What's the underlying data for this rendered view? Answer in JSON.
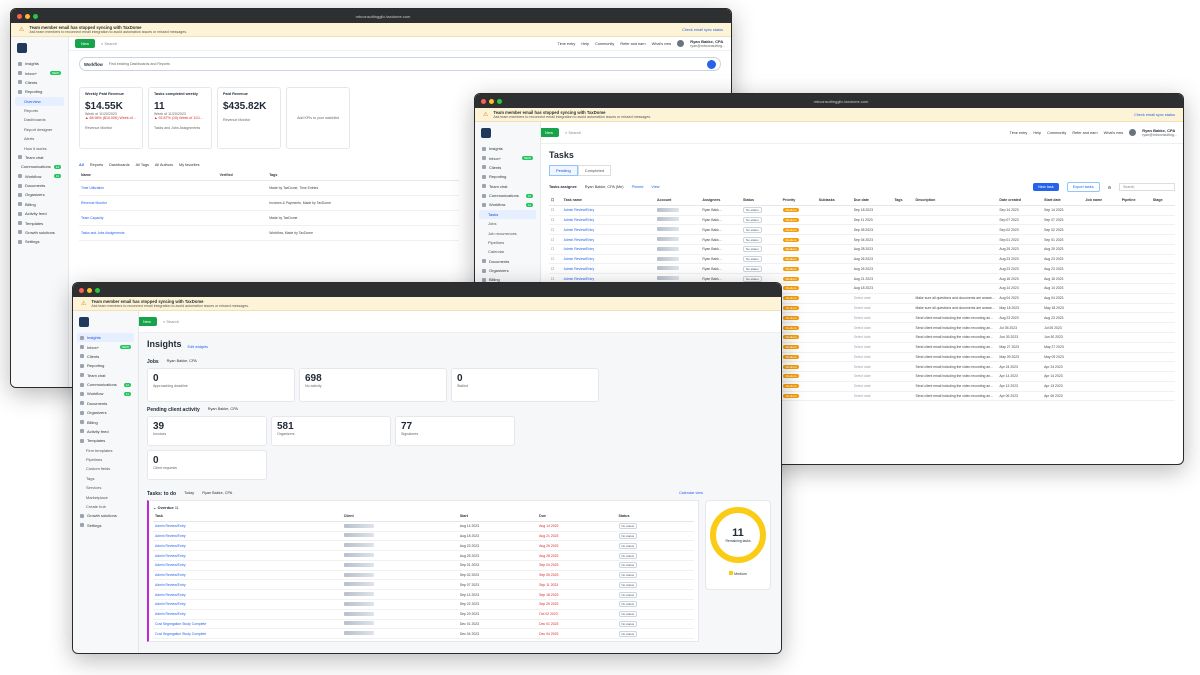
{
  "banner": {
    "title": "Team member email has stopped syncing with TaxDome",
    "desc": "Ask team members to reconnect email integration to avoid automation issues or missed messages.",
    "link": "Check email sync status"
  },
  "urls": {
    "back": "mbconsultinggllc.taxdome.com",
    "mid": "mbconsultinggllc.taxdome.com"
  },
  "topbar": {
    "new": "New",
    "search": "Search",
    "time_entry": "Time entry",
    "help": "Help",
    "community": "Community",
    "refer": "Refer and earn",
    "whats_new": "What's new",
    "user_name": "Ryan Bakke, CPA",
    "user_email": "ryan@mbconsulting..."
  },
  "sidebar_back": [
    "Insights",
    "Inbox+",
    "Clients",
    "Reporting",
    "Overview",
    "Reports",
    "Dashboards",
    "Report designer",
    "Alerts",
    "How it works",
    "Team chat",
    "Communications",
    "Workflow",
    "Documents",
    "Organizers",
    "Billing",
    "Activity feed",
    "Templates",
    "Growth solutions",
    "Settings"
  ],
  "sidebar_right": [
    "Insights",
    "Inbox+",
    "Clients",
    "Reporting",
    "Team chat",
    "Communications",
    "Workflow",
    "Tasks",
    "Jobs",
    "Job recurrences",
    "Pipelines",
    "Calendar",
    "Documents",
    "Organizers",
    "Billing",
    "Activity feed",
    "Templates",
    "Growth solutions",
    "Settings"
  ],
  "sidebar_front": [
    "Insights",
    "Inbox+",
    "Clients",
    "Reporting",
    "Team chat",
    "Communications",
    "Workflow",
    "Documents",
    "Organizers",
    "Billing",
    "Activity feed",
    "Templates",
    "Firm templates",
    "Pipelines",
    "Custom fields",
    "Tags",
    "Services",
    "Marketplace",
    "Create hub",
    "Growth solutions",
    "Settings"
  ],
  "badges": {
    "inbox": "NEW",
    "comm": "12",
    "workflow": "11"
  },
  "back": {
    "workflow_label": "Workflow",
    "ask": "Find existing Dashboards and Reports",
    "cards": [
      {
        "title": "Weekly Paid Revenue",
        "value": "$14.55K",
        "sub": "Week of 11/20/2023",
        "delta": "▲ 68.98% ($10.00K) Week of...",
        "foot": "Revenue Monitor"
      },
      {
        "title": "Tasks completed weekly",
        "value": "11",
        "sub": "Week of 11/20/2023",
        "delta": "▲ 92.87% (10) Week of 11/1...",
        "foot": "Tasks and Jobs Assignments"
      },
      {
        "title": "Paid Revenue",
        "value": "$435.82K",
        "sub": "",
        "delta": "",
        "foot": "Revenue Monitor"
      }
    ],
    "add_kpi": "Add KPIs to your watchlist",
    "filters": [
      "All",
      "Reports",
      "Dashboards",
      "All Tags",
      "All Authors",
      "My favorites"
    ],
    "cols": [
      "Name",
      "Verified",
      "Tags"
    ],
    "rows": [
      {
        "name": "Time Utilization",
        "tags": "Made by TaxDome, Time Entries"
      },
      {
        "name": "Revenue Monitor",
        "tags": "Invoices & Payments, Made by TaxDome"
      },
      {
        "name": "Team Capacity",
        "tags": "Made by TaxDome"
      },
      {
        "name": "Tasks and Jobs Assignments",
        "tags": "Workflow, Made by TaxDome"
      }
    ]
  },
  "right": {
    "title": "Tasks",
    "tabs": [
      "Pending",
      "Completed"
    ],
    "filter1": "Tasks assignee",
    "filter2": "Ryan Bakke, CPA (Me)",
    "filter3": "Pinned",
    "filter4": "View",
    "new_task": "New task",
    "export": "Export tasks",
    "search": "Search",
    "cols": [
      "Task name",
      "Account",
      "Assignees",
      "Status",
      "Priority",
      "Subtasks",
      "Due date",
      "Tags",
      "Description",
      "Date created",
      "Start date",
      "Job name",
      "Pipeline",
      "Stage"
    ],
    "rows": [
      {
        "n": "Admin Review/Entry",
        "d": "Sep 18 2023",
        "c": "Sep 14 2023",
        "s": "Sep 14 2023",
        "desc": ""
      },
      {
        "n": "Admin Review/Entry",
        "d": "Sep 11 2023",
        "c": "Sep 07 2023",
        "s": "Sep 07 2023",
        "desc": ""
      },
      {
        "n": "Admin Review/Entry",
        "d": "Sep 05 2023",
        "c": "Sep 02 2023",
        "s": "Sep 02 2023",
        "desc": ""
      },
      {
        "n": "Admin Review/Entry",
        "d": "Sep 04 2023",
        "c": "Sep 01 2023",
        "s": "Sep 01 2023",
        "desc": ""
      },
      {
        "n": "Admin Review/Entry",
        "d": "Aug 28 2023",
        "c": "Aug 25 2023",
        "s": "Aug 25 2023",
        "desc": ""
      },
      {
        "n": "Admin Review/Entry",
        "d": "Aug 26 2023",
        "c": "Aug 23 2023",
        "s": "Aug 23 2023",
        "desc": ""
      },
      {
        "n": "Admin Review/Entry",
        "d": "Aug 26 2023",
        "c": "Aug 23 2023",
        "s": "Aug 23 2023",
        "desc": ""
      },
      {
        "n": "Admin Review/Entry",
        "d": "Aug 21 2023",
        "c": "Aug 18 2023",
        "s": "Aug 18 2023",
        "desc": ""
      },
      {
        "n": "Admin Review/Entry",
        "d": "Aug 18 2023",
        "c": "Aug 14 2023",
        "s": "Aug 14 2023",
        "desc": ""
      },
      {
        "n": "Advisory: Confirm Onboarding...",
        "d": "Select date",
        "c": "Aug 04 2023",
        "s": "Aug 04 2023",
        "desc": "Make sure all questions and documents are answered an..."
      },
      {
        "n": "Advisory: Confirm Onboarding...",
        "d": "Select date",
        "c": "May 18 2023",
        "s": "May 18 2023",
        "desc": "Make sure all questions and documents are answered an..."
      },
      {
        "n": "Advisory: Send Consulting Call...",
        "d": "Select date",
        "c": "Aug 23 2023",
        "s": "Aug 23 2023",
        "desc": "Send client email including the video recording and any..."
      },
      {
        "n": "Advisory: Send Consulting Call...",
        "d": "Select date",
        "c": "Jul 05 2023",
        "s": "Jul 05 2023",
        "desc": "Send client email including the video recording and any..."
      },
      {
        "n": "Advisory: Send Consulting Call...",
        "d": "Select date",
        "c": "Jun 30 2023",
        "s": "Jun 30 2023",
        "desc": "Send client email including the video recording and any..."
      },
      {
        "n": "Advisory: Send Consulting Call...",
        "d": "Select date",
        "c": "May 27 2023",
        "s": "May 27 2023",
        "desc": "Send client email including the video recording and any..."
      },
      {
        "n": "Advisory: Send Consulting Call...",
        "d": "Select date",
        "c": "May 09 2023",
        "s": "May 09 2023",
        "desc": "Send client email including the video recording and any..."
      },
      {
        "n": "Advisory: Send Consulting Call...",
        "d": "Select date",
        "c": "Apr 24 2023",
        "s": "Apr 24 2023",
        "desc": "Send client email including the video recording and any..."
      },
      {
        "n": "Advisory: Send Consulting Call...",
        "d": "Select date",
        "c": "Apr 14 2023",
        "s": "Apr 14 2023",
        "desc": "Send client email including the video recording and any..."
      },
      {
        "n": "Advisory: Send Consulting Call...",
        "d": "Select date",
        "c": "Apr 13 2023",
        "s": "Apr 13 2023",
        "desc": "Send client email including the video recording and any..."
      },
      {
        "n": "Advisory: Send Consulting Call...",
        "d": "Select date",
        "c": "Apr 06 2023",
        "s": "Apr 06 2023",
        "desc": "Send client email including the video recording and any..."
      }
    ],
    "assignee": "Ryan Bakk...",
    "status": "No status",
    "priority": "Medium"
  },
  "front": {
    "title": "Insights",
    "edit": "Edit widgets",
    "jobs": "Jobs",
    "who": "Ryan Bakke, CPA",
    "today": "Today",
    "next7": "Next 7 days",
    "job_cards": [
      {
        "v": "0",
        "l": "Approaching deadline"
      },
      {
        "v": "698",
        "l": "No activity"
      },
      {
        "v": "0",
        "l": "Stalled"
      }
    ],
    "pending": "Pending client activity",
    "pend_cards": [
      {
        "v": "39",
        "l": "Invoices"
      },
      {
        "v": "581",
        "l": "Organizers"
      },
      {
        "v": "77",
        "l": "Signatures"
      },
      {
        "v": "0",
        "l": "Client requests"
      }
    ],
    "todo": "Tasks: to do",
    "overdue": "Overdue",
    "overdue_count": "11",
    "cal": "Calendar view",
    "cols": [
      "Task",
      "Client",
      "Start",
      "Due",
      "Status"
    ],
    "rows": [
      {
        "t": "Admin Review/Entry",
        "s": "Aug 14 2023",
        "d": "Aug 14 2023"
      },
      {
        "t": "Admin Review/Entry",
        "s": "Aug 18 2023",
        "d": "Aug 21 2023"
      },
      {
        "t": "Admin Review/Entry",
        "s": "Aug 23 2023",
        "d": "Aug 26 2023"
      },
      {
        "t": "Admin Review/Entry",
        "s": "Aug 25 2023",
        "d": "Aug 28 2023"
      },
      {
        "t": "Admin Review/Entry",
        "s": "Sep 01 2023",
        "d": "Sep 04 2023"
      },
      {
        "t": "Admin Review/Entry",
        "s": "Sep 02 2023",
        "d": "Sep 05 2023"
      },
      {
        "t": "Admin Review/Entry",
        "s": "Sep 07 2023",
        "d": "Sep 11 2023"
      },
      {
        "t": "Admin Review/Entry",
        "s": "Sep 14 2023",
        "d": "Sep 18 2023"
      },
      {
        "t": "Admin Review/Entry",
        "s": "Sep 22 2023",
        "d": "Sep 25 2023"
      },
      {
        "t": "Admin Review/Entry",
        "s": "Sep 29 2023",
        "d": "Oct 02 2023"
      },
      {
        "t": "Cost Segregation Study Complete",
        "s": "Dec 01 2023",
        "d": "Dec 01 2023"
      },
      {
        "t": "Cost Segregation Study Complete",
        "s": "Dec 04 2023",
        "d": "Dec 04 2023"
      }
    ],
    "status": "No status",
    "donut_num": "11",
    "donut_lbl": "Remaining tasks",
    "legend": "Medium"
  }
}
